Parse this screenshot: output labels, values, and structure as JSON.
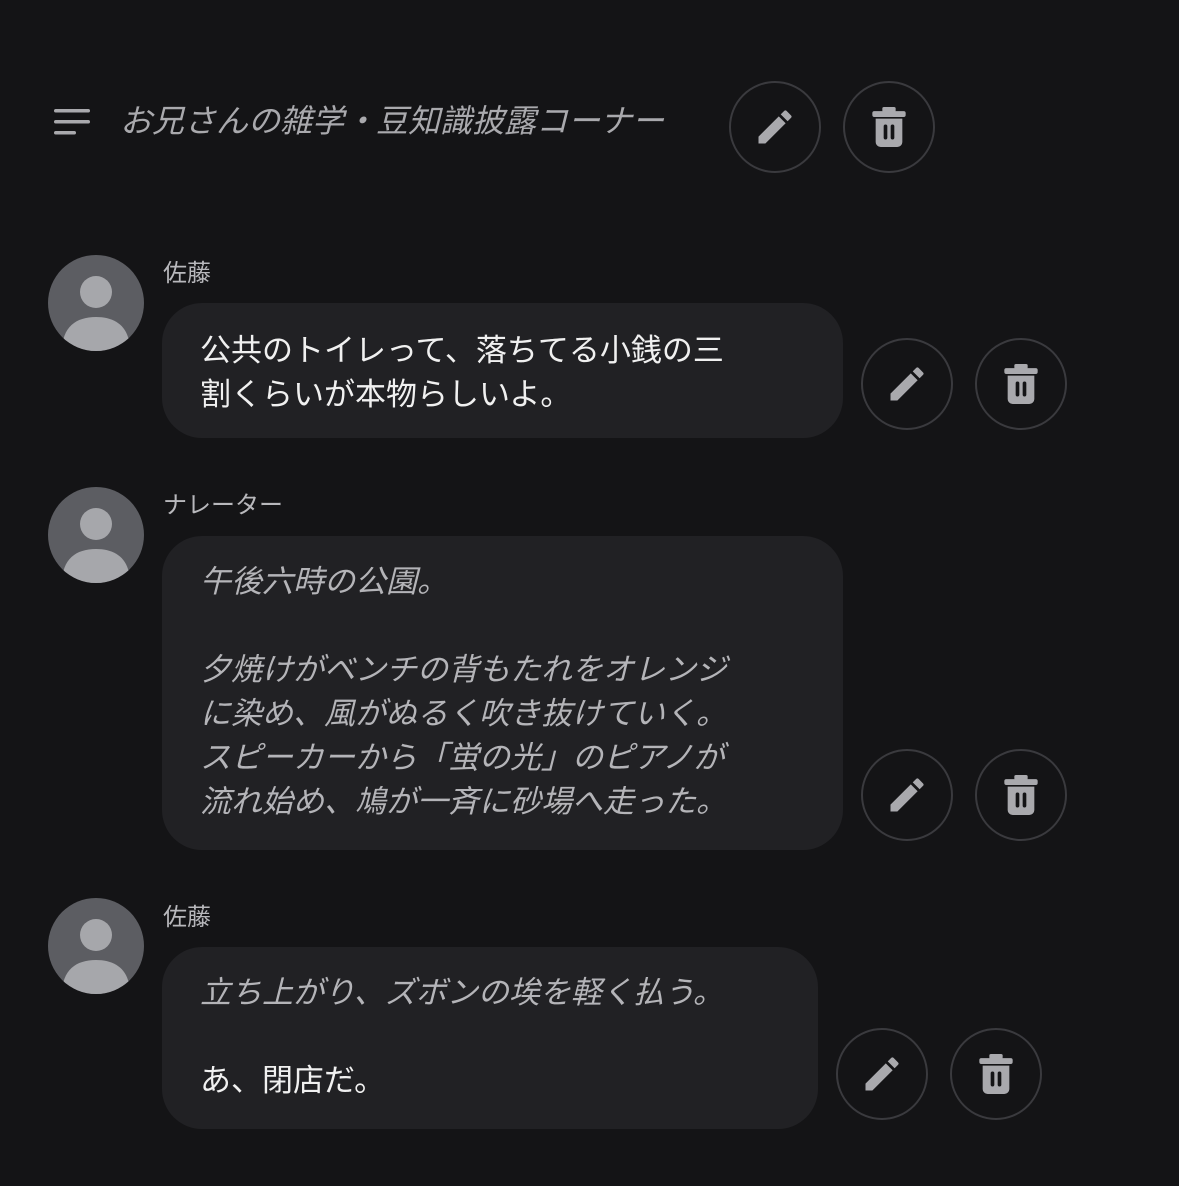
{
  "header": {
    "title": "お兄さんの雑学・豆知識披露コーナー",
    "icons": {
      "menu": "menu-lines-icon",
      "edit": "pencil-icon",
      "delete": "trash-icon"
    }
  },
  "messages": [
    {
      "speaker": "佐藤",
      "lines": [
        {
          "text": "公共のトイレって、落ちてる小銭の三",
          "style": "normal"
        },
        {
          "text": "割くらいが本物らしいよ。",
          "style": "normal"
        }
      ]
    },
    {
      "speaker": "ナレーター",
      "lines": [
        {
          "text": "午後六時の公園。",
          "style": "italic"
        },
        {
          "text": "",
          "style": "blank"
        },
        {
          "text": "夕焼けがベンチの背もたれをオレンジ",
          "style": "italic"
        },
        {
          "text": "に染め、風がぬるく吹き抜けていく。",
          "style": "italic"
        },
        {
          "text": "スピーカーから「蛍の光」のピアノが",
          "style": "italic"
        },
        {
          "text": "流れ始め、鳩が一斉に砂場へ走った。",
          "style": "italic"
        }
      ]
    },
    {
      "speaker": "佐藤",
      "lines": [
        {
          "text": "立ち上がり、ズボンの埃を軽く払う。",
          "style": "italic"
        },
        {
          "text": "",
          "style": "blank"
        },
        {
          "text": "あ、閉店だ。",
          "style": "normal"
        }
      ]
    }
  ],
  "colors": {
    "background": "#141416",
    "bubble": "#212124",
    "avatar": "#5c5d62",
    "avatar_figure": "#a6a7ab",
    "icon": "#a9a9ad",
    "button_border": "#3a3a3e"
  }
}
